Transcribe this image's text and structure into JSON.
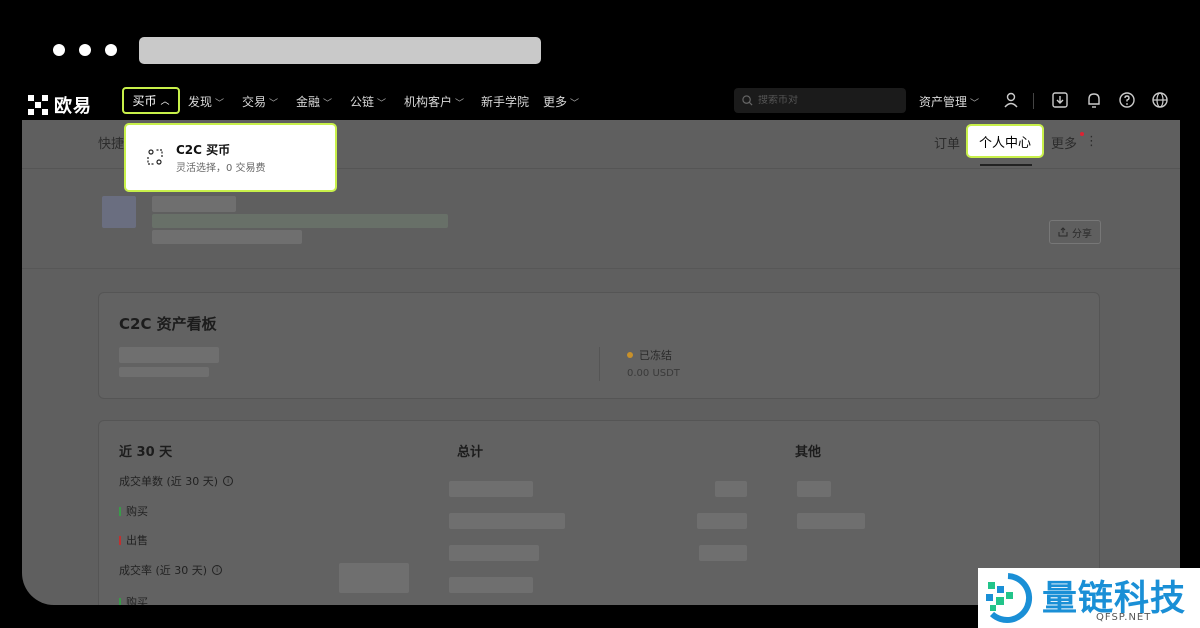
{
  "nav": {
    "logo_text": "欧易",
    "buy_label": "买币",
    "items": [
      "发现",
      "交易",
      "金融",
      "公链",
      "机构客户",
      "新手学院",
      "更多"
    ],
    "search_placeholder": "搜索币对",
    "asset_mgmt": "资产管理"
  },
  "dropdown": {
    "title": "C2C 买币",
    "subtitle": "灵活选择，0 交易费"
  },
  "subbar": {
    "quick": "快捷",
    "orders": "订单",
    "personal_center": "个人中心",
    "more": "更多",
    "kebab": "⋮"
  },
  "profile": {
    "share_label": "分享"
  },
  "asset_board": {
    "title": "C2C 资产看板",
    "frozen_label": "已冻结",
    "frozen_value": "0.00 USDT"
  },
  "stats": {
    "col1": "近 30 天",
    "col2": "总计",
    "col3": "其他",
    "rows": [
      "成交单数 (近 30 天)",
      "购买",
      "出售",
      "成交率 (近 30 天)",
      "购买"
    ]
  },
  "watermark": {
    "text": "量链科技",
    "sub": "QFSP.NET"
  },
  "colors": {
    "highlight": "#c8f04a",
    "buy_green": "#3a9a4a",
    "sell_red": "#c03030",
    "frozen_dot": "#c8902a",
    "watermark_blue": "#1a8fd6"
  }
}
